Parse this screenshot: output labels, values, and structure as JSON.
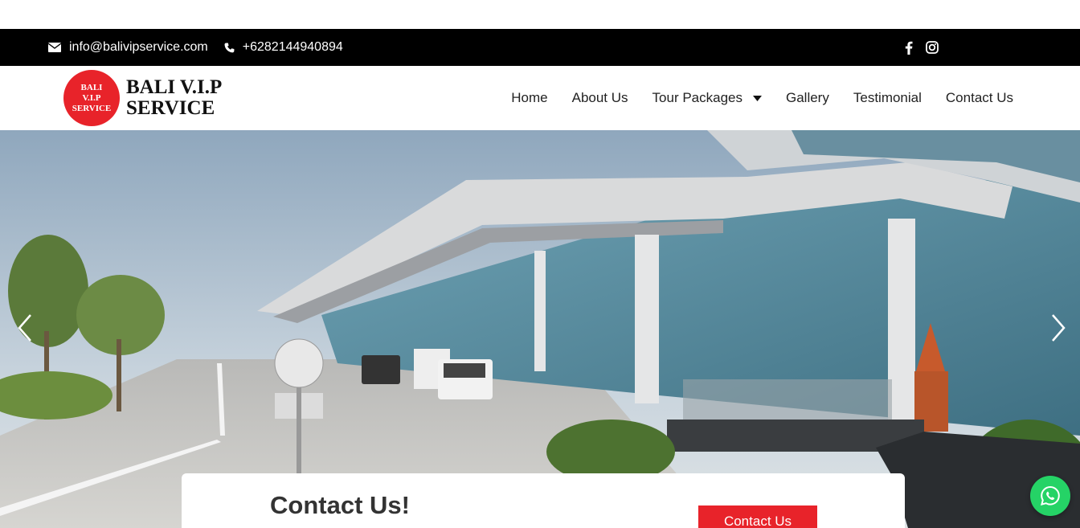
{
  "topbar": {
    "email": "info@balivipservice.com",
    "phone": "+6282144940894",
    "email_icon": "envelope-icon",
    "phone_icon": "phone-icon",
    "social": [
      "facebook-icon",
      "instagram-icon"
    ]
  },
  "logo": {
    "badge_line1": "BALI",
    "badge_line2": "V.I.P",
    "badge_line3": "SERVICE",
    "text_line1": "BALI V.I.P",
    "text_line2": "SERVICE",
    "badge_color": "#e8232a"
  },
  "nav": {
    "home": "Home",
    "about": "About Us",
    "tours": "Tour Packages",
    "gallery": "Gallery",
    "testimonial": "Testimonial",
    "contact": "Contact Us"
  },
  "hero": {
    "image": "Airport terminal photo",
    "prev_icon": "chevron-left-icon",
    "next_icon": "chevron-right-icon"
  },
  "cta": {
    "title": "Contact Us!",
    "button": "Contact Us",
    "button_color": "#e8232a"
  },
  "whatsapp": {
    "icon": "whatsapp-icon",
    "color": "#25d366"
  }
}
